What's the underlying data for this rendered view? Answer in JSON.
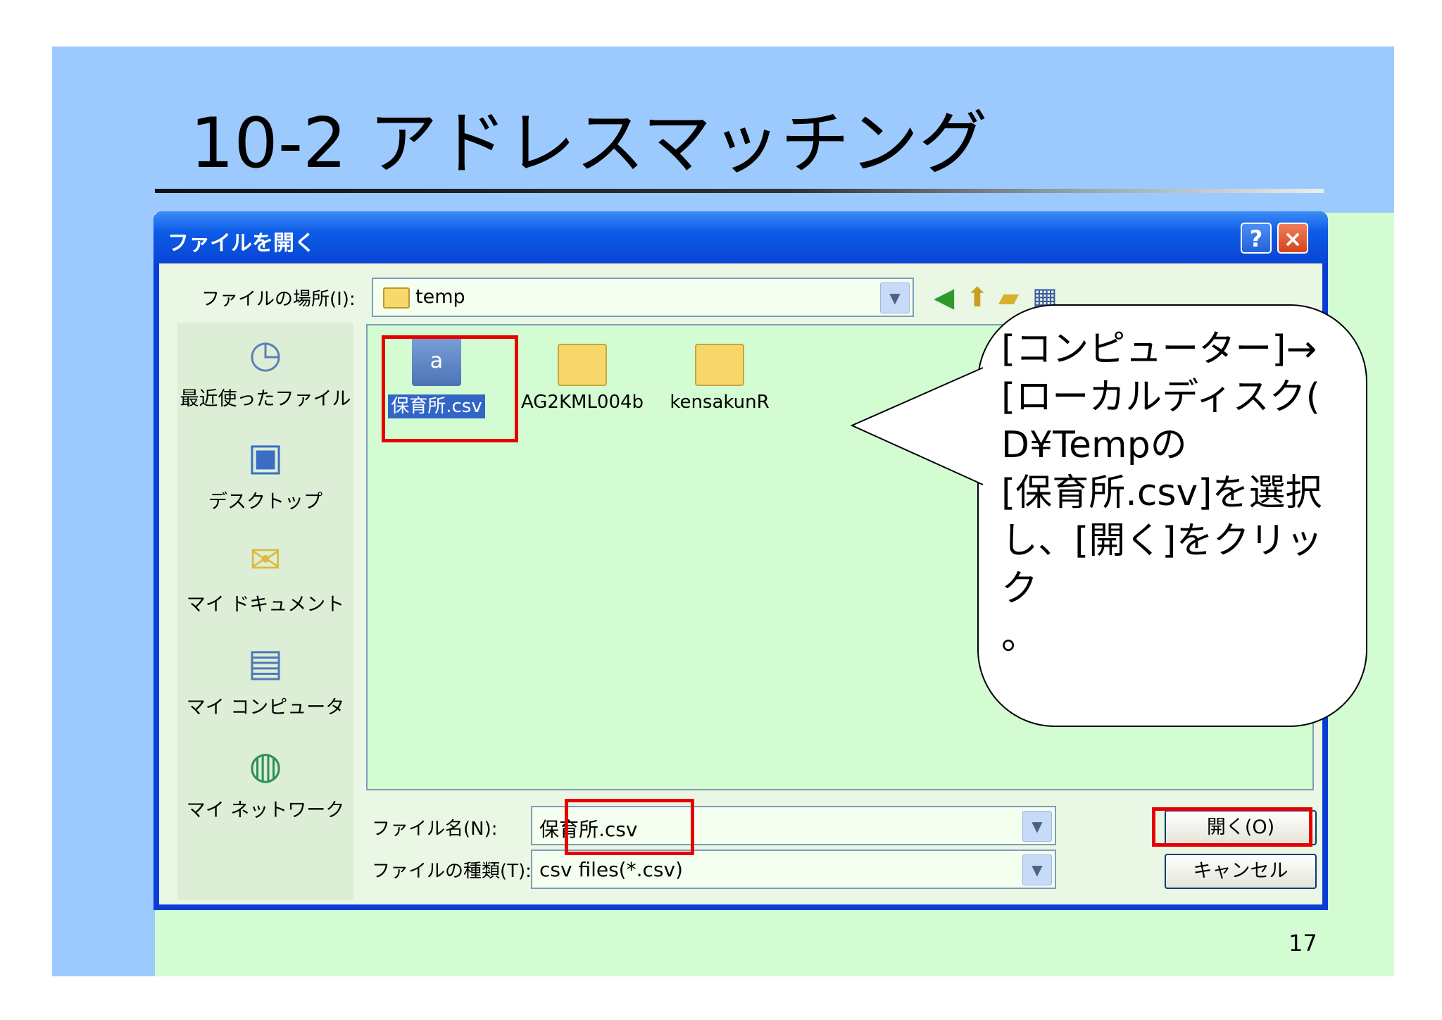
{
  "slide": {
    "title": "10-2 アドレスマッチング",
    "page_number": "17"
  },
  "dialog": {
    "title": "ファイルを開く",
    "help_label": "?",
    "close_label": "×",
    "look_in_label": "ファイルの場所(I):",
    "look_in_value": "temp",
    "toolbar_icons": [
      "back-icon",
      "up-folder-icon",
      "new-folder-icon",
      "view-menu-icon"
    ],
    "places": [
      {
        "label": "最近使ったファイル",
        "icon": "recent-files-icon"
      },
      {
        "label": "デスクトップ",
        "icon": "desktop-icon"
      },
      {
        "label": "マイ ドキュメント",
        "icon": "my-documents-icon"
      },
      {
        "label": "マイ コンピュータ",
        "icon": "my-computer-icon"
      },
      {
        "label": "マイ ネットワーク",
        "icon": "my-network-icon"
      }
    ],
    "files": [
      {
        "name": "保育所.csv",
        "type": "csv",
        "selected": true
      },
      {
        "name": "AG2KML004b",
        "type": "folder",
        "selected": false
      },
      {
        "name": "kensakunR",
        "type": "folder",
        "selected": false
      }
    ],
    "filename_label": "ファイル名(N):",
    "filename_value": "保育所.csv",
    "filetype_label": "ファイルの種類(T):",
    "filetype_value": "csv files(*.csv)",
    "open_button": "開く(O)",
    "cancel_button": "キャンセル"
  },
  "callout": {
    "lines": [
      "[コンピューター]→",
      "[ローカルディスク(",
      "D¥Tempの",
      "[保育所.csv]を選択",
      "し、[開く]をクリック",
      "。"
    ]
  },
  "colors": {
    "slide_bg": "#d3fcd3",
    "band": "#9ccaff",
    "titlebar": "#0c5be6",
    "highlight_box": "#e60000"
  }
}
